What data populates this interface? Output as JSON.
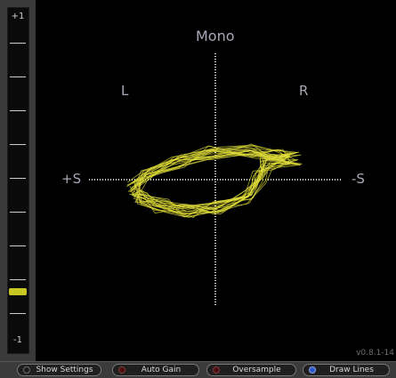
{
  "meter": {
    "top_label": "+1",
    "bottom_label": "-1",
    "level": 0.13
  },
  "scope": {
    "labels": {
      "mono": "Mono",
      "left": "L",
      "right": "R",
      "plus_s": "+S",
      "minus_s": "-S"
    },
    "trace_color": "#e0dd3a",
    "axis_color": "#d0d0d0"
  },
  "version": "v0.8.1-14",
  "toolbar": {
    "buttons": [
      {
        "label": "Show Settings",
        "led": "off"
      },
      {
        "label": "Auto Gain",
        "led": "red"
      },
      {
        "label": "Oversample",
        "led": "red"
      },
      {
        "label": "Draw Lines",
        "led": "on"
      }
    ]
  }
}
